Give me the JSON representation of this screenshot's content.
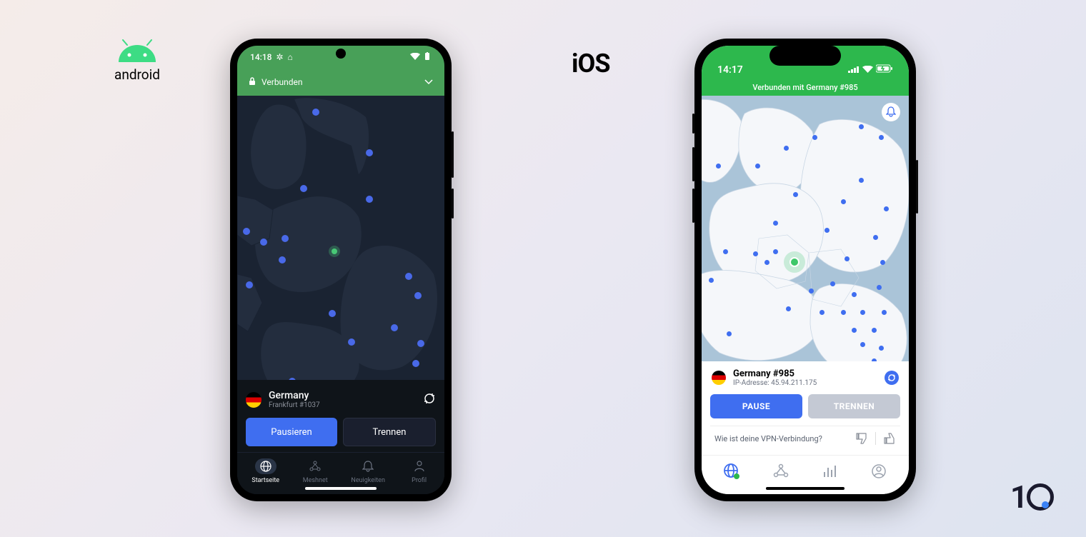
{
  "os_labels": {
    "android": "android",
    "ios": "iOS"
  },
  "android": {
    "status_time": "14:18",
    "connected_label": "Verbunden",
    "server": {
      "country": "Germany",
      "detail": "Frankfurt #1037"
    },
    "buttons": {
      "pause": "Pausieren",
      "disconnect": "Trennen"
    },
    "nav": {
      "home": "Startseite",
      "meshnet": "Meshnet",
      "news": "Neuigkeiten",
      "profile": "Profil"
    }
  },
  "ios": {
    "status_time": "14:17",
    "connected_label": "Verbunden mit Germany #985",
    "server": {
      "name": "Germany #985",
      "ip": "IP-Adresse: 45.94.211.175"
    },
    "buttons": {
      "pause": "PAUSE",
      "disconnect": "TRENNEN"
    },
    "feedback_prompt": "Wie ist deine VPN-Verbindung?"
  },
  "watermark": {
    "digit": "1"
  }
}
